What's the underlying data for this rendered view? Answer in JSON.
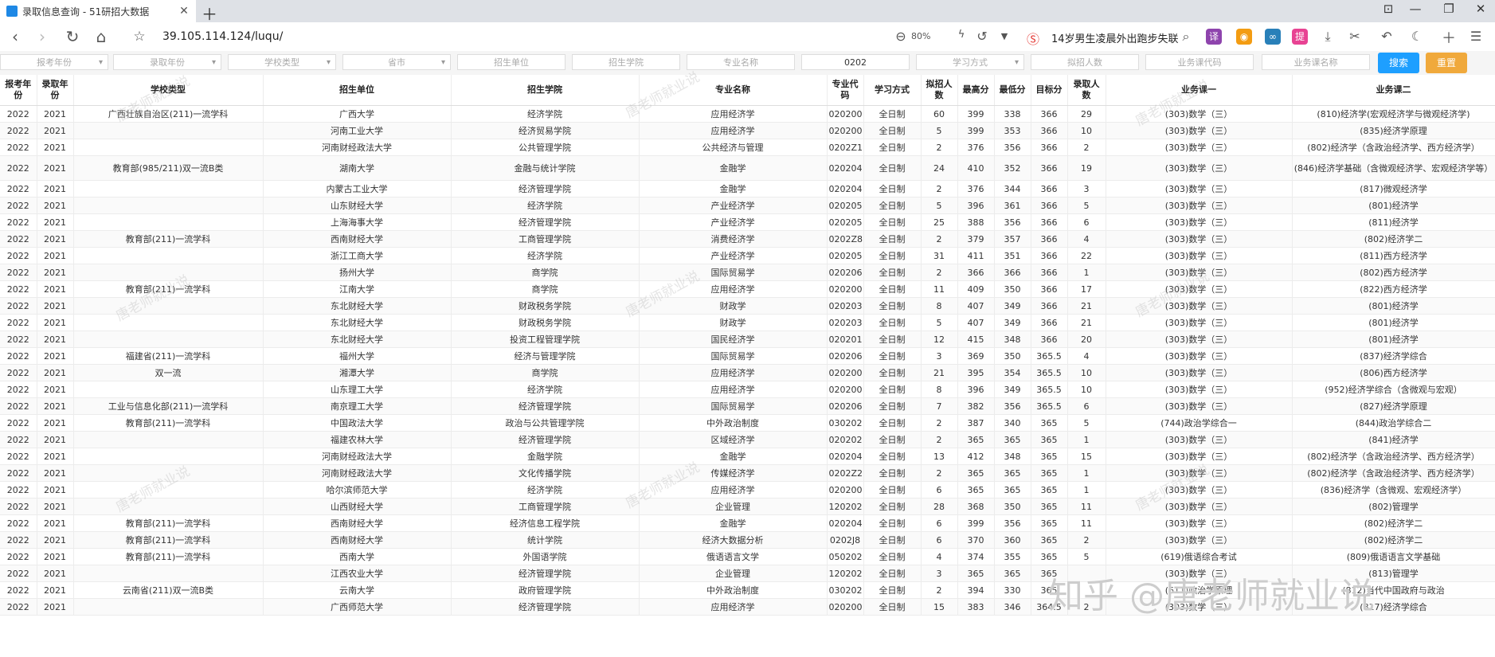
{
  "browser": {
    "tab_title": "录取信息查询 - 51研招大数据",
    "url": "39.105.114.124/luqu/",
    "zoom": "80%",
    "hot_search": "14岁男生凌晨外出跑步失联"
  },
  "filters": {
    "year_report": "报考年份",
    "year_admit": "录取年份",
    "school_type": "学校类型",
    "province": "省市",
    "unit": "招生单位",
    "college": "招生学院",
    "major_name": "专业名称",
    "major_code": "0202",
    "study_mode": "学习方式",
    "plan_count": "拟招人数",
    "course_code": "业务课代码",
    "course_name": "业务课名称",
    "search": "搜索",
    "reset": "重置"
  },
  "table": {
    "headers": [
      "报考年份",
      "录取年份",
      "学校类型",
      "招生单位",
      "招生学院",
      "专业名称",
      "专业代码",
      "学习方式",
      "拟招人数",
      "最高分",
      "最低分",
      "目标分",
      "录取人数",
      "业务课一",
      "业务课二"
    ],
    "rows": [
      [
        "2022",
        "2021",
        "广西壮族自治区(211)一流学科",
        "广西大学",
        "经济学院",
        "应用经济学",
        "020200",
        "全日制",
        "60",
        "399",
        "338",
        "366",
        "29",
        "(303)数学（三）",
        "(810)经济学(宏观经济学与微观经济学)"
      ],
      [
        "2022",
        "2021",
        "",
        "河南工业大学",
        "经济贸易学院",
        "应用经济学",
        "020200",
        "全日制",
        "5",
        "399",
        "353",
        "366",
        "10",
        "(303)数学（三）",
        "(835)经济学原理"
      ],
      [
        "2022",
        "2021",
        "",
        "河南财经政法大学",
        "公共管理学院",
        "公共经济与管理",
        "0202Z1",
        "全日制",
        "2",
        "376",
        "356",
        "366",
        "2",
        "(303)数学（三）",
        "(802)经济学（含政治经济学、西方经济学）"
      ],
      [
        "2022",
        "2021",
        "教育部(985/211)双一流B类",
        "湖南大学",
        "金融与统计学院",
        "金融学",
        "020204",
        "全日制",
        "24",
        "410",
        "352",
        "366",
        "19",
        "(303)数学（三）",
        "(846)经济学基础（含微观经济学、宏观经济学等）"
      ],
      [
        "2022",
        "2021",
        "",
        "内蒙古工业大学",
        "经济管理学院",
        "金融学",
        "020204",
        "全日制",
        "2",
        "376",
        "344",
        "366",
        "3",
        "(303)数学（三）",
        "(817)微观经济学"
      ],
      [
        "2022",
        "2021",
        "",
        "山东财经大学",
        "经济学院",
        "产业经济学",
        "020205",
        "全日制",
        "5",
        "396",
        "361",
        "366",
        "5",
        "(303)数学（三）",
        "(801)经济学"
      ],
      [
        "2022",
        "2021",
        "",
        "上海海事大学",
        "经济管理学院",
        "产业经济学",
        "020205",
        "全日制",
        "25",
        "388",
        "356",
        "366",
        "6",
        "(303)数学（三）",
        "(811)经济学"
      ],
      [
        "2022",
        "2021",
        "教育部(211)一流学科",
        "西南财经大学",
        "工商管理学院",
        "消费经济学",
        "0202Z8",
        "全日制",
        "2",
        "379",
        "357",
        "366",
        "4",
        "(303)数学（三）",
        "(802)经济学二"
      ],
      [
        "2022",
        "2021",
        "",
        "浙江工商大学",
        "经济学院",
        "产业经济学",
        "020205",
        "全日制",
        "31",
        "411",
        "351",
        "366",
        "22",
        "(303)数学（三）",
        "(811)西方经济学"
      ],
      [
        "2022",
        "2021",
        "",
        "扬州大学",
        "商学院",
        "国际贸易学",
        "020206",
        "全日制",
        "2",
        "366",
        "366",
        "366",
        "1",
        "(303)数学（三）",
        "(802)西方经济学"
      ],
      [
        "2022",
        "2021",
        "教育部(211)一流学科",
        "江南大学",
        "商学院",
        "应用经济学",
        "020200",
        "全日制",
        "11",
        "409",
        "350",
        "366",
        "17",
        "(303)数学（三）",
        "(822)西方经济学"
      ],
      [
        "2022",
        "2021",
        "",
        "东北财经大学",
        "财政税务学院",
        "财政学",
        "020203",
        "全日制",
        "8",
        "407",
        "349",
        "366",
        "21",
        "(303)数学（三）",
        "(801)经济学"
      ],
      [
        "2022",
        "2021",
        "",
        "东北财经大学",
        "财政税务学院",
        "财政学",
        "020203",
        "全日制",
        "5",
        "407",
        "349",
        "366",
        "21",
        "(303)数学（三）",
        "(801)经济学"
      ],
      [
        "2022",
        "2021",
        "",
        "东北财经大学",
        "投资工程管理学院",
        "国民经济学",
        "020201",
        "全日制",
        "12",
        "415",
        "348",
        "366",
        "20",
        "(303)数学（三）",
        "(801)经济学"
      ],
      [
        "2022",
        "2021",
        "福建省(211)一流学科",
        "福州大学",
        "经济与管理学院",
        "国际贸易学",
        "020206",
        "全日制",
        "3",
        "369",
        "350",
        "365.5",
        "4",
        "(303)数学（三）",
        "(837)经济学综合"
      ],
      [
        "2022",
        "2021",
        "双一流",
        "湘潭大学",
        "商学院",
        "应用经济学",
        "020200",
        "全日制",
        "21",
        "395",
        "354",
        "365.5",
        "10",
        "(303)数学（三）",
        "(806)西方经济学"
      ],
      [
        "2022",
        "2021",
        "",
        "山东理工大学",
        "经济学院",
        "应用经济学",
        "020200",
        "全日制",
        "8",
        "396",
        "349",
        "365.5",
        "10",
        "(303)数学（三）",
        "(952)经济学综合（含微观与宏观）"
      ],
      [
        "2022",
        "2021",
        "工业与信息化部(211)一流学科",
        "南京理工大学",
        "经济管理学院",
        "国际贸易学",
        "020206",
        "全日制",
        "7",
        "382",
        "356",
        "365.5",
        "6",
        "(303)数学（三）",
        "(827)经济学原理"
      ],
      [
        "2022",
        "2021",
        "教育部(211)一流学科",
        "中国政法大学",
        "政治与公共管理学院",
        "中外政治制度",
        "030202",
        "全日制",
        "2",
        "387",
        "340",
        "365",
        "5",
        "(744)政治学综合一",
        "(844)政治学综合二"
      ],
      [
        "2022",
        "2021",
        "",
        "福建农林大学",
        "经济管理学院",
        "区域经济学",
        "020202",
        "全日制",
        "2",
        "365",
        "365",
        "365",
        "1",
        "(303)数学（三）",
        "(841)经济学"
      ],
      [
        "2022",
        "2021",
        "",
        "河南财经政法大学",
        "金融学院",
        "金融学",
        "020204",
        "全日制",
        "13",
        "412",
        "348",
        "365",
        "15",
        "(303)数学（三）",
        "(802)经济学（含政治经济学、西方经济学）"
      ],
      [
        "2022",
        "2021",
        "",
        "河南财经政法大学",
        "文化传播学院",
        "传媒经济学",
        "0202Z2",
        "全日制",
        "2",
        "365",
        "365",
        "365",
        "1",
        "(303)数学（三）",
        "(802)经济学（含政治经济学、西方经济学）"
      ],
      [
        "2022",
        "2021",
        "",
        "哈尔滨师范大学",
        "经济学院",
        "应用经济学",
        "020200",
        "全日制",
        "6",
        "365",
        "365",
        "365",
        "1",
        "(303)数学（三）",
        "(836)经济学（含微观、宏观经济学）"
      ],
      [
        "2022",
        "2021",
        "",
        "山西财经大学",
        "工商管理学院",
        "企业管理",
        "120202",
        "全日制",
        "28",
        "368",
        "350",
        "365",
        "11",
        "(303)数学（三）",
        "(802)管理学"
      ],
      [
        "2022",
        "2021",
        "教育部(211)一流学科",
        "西南财经大学",
        "经济信息工程学院",
        "金融学",
        "020204",
        "全日制",
        "6",
        "399",
        "356",
        "365",
        "11",
        "(303)数学（三）",
        "(802)经济学二"
      ],
      [
        "2022",
        "2021",
        "教育部(211)一流学科",
        "西南财经大学",
        "统计学院",
        "经济大数据分析",
        "0202J8",
        "全日制",
        "6",
        "370",
        "360",
        "365",
        "2",
        "(303)数学（三）",
        "(802)经济学二"
      ],
      [
        "2022",
        "2021",
        "教育部(211)一流学科",
        "西南大学",
        "外国语学院",
        "俄语语言文学",
        "050202",
        "全日制",
        "4",
        "374",
        "355",
        "365",
        "5",
        "(619)俄语综合考试",
        "(809)俄语语言文学基础"
      ],
      [
        "2022",
        "2021",
        "",
        "江西农业大学",
        "经济管理学院",
        "企业管理",
        "120202",
        "全日制",
        "3",
        "365",
        "365",
        "365",
        "",
        "(303)数学（三）",
        "(813)管理学"
      ],
      [
        "2022",
        "2021",
        "云南省(211)双一流B类",
        "云南大学",
        "政府管理学院",
        "中外政治制度",
        "030202",
        "全日制",
        "2",
        "394",
        "330",
        "365",
        "",
        "(611)政治学原理",
        "(812)当代中国政府与政治"
      ],
      [
        "2022",
        "2021",
        "",
        "广西师范大学",
        "经济管理学院",
        "应用经济学",
        "020200",
        "全日制",
        "15",
        "383",
        "346",
        "364.5",
        "2",
        "(303)数学（三）",
        "(817)经济学综合"
      ]
    ]
  },
  "watermarks": {
    "tiled": "唐老师就业说",
    "zhihu": "知乎 @唐老师就业说"
  }
}
